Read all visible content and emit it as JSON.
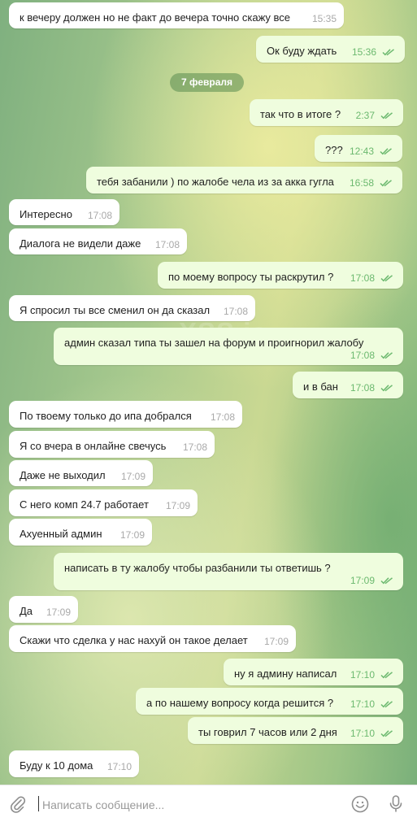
{
  "date_separator": "7 февраля",
  "watermark": "XSS.is",
  "messages": [
    {
      "dir": "in",
      "text": "к вечеру должен но не факт до вечера точно скажу все",
      "time": "15:35"
    },
    {
      "dir": "out",
      "text": "Ок буду ждать",
      "time": "15:36"
    },
    {
      "dir": "out",
      "text": "так что в итоге ?",
      "time": "2:37"
    },
    {
      "dir": "out",
      "text": "???",
      "time": "12:43"
    },
    {
      "dir": "out",
      "text": "тебя забанили ) по жалобе чела из за акка гугла",
      "time": "16:58"
    },
    {
      "dir": "in",
      "text": "Интересно",
      "time": "17:08"
    },
    {
      "dir": "in",
      "text": "Диалога не видели даже",
      "time": "17:08"
    },
    {
      "dir": "out",
      "text": "по моему вопросу ты раскрутил ?",
      "time": "17:08"
    },
    {
      "dir": "in",
      "text": "Я спросил ты все сменил он да сказал",
      "time": "17:08"
    },
    {
      "dir": "out",
      "text": "админ сказал типа ты зашел на форум и проигнорил жалобу",
      "time": "17:08"
    },
    {
      "dir": "out",
      "text": "и в бан",
      "time": "17:08"
    },
    {
      "dir": "in",
      "text": "По твоему только до ипа добрался",
      "time": "17:08"
    },
    {
      "dir": "in",
      "text": "Я со вчера в онлайне свечусь",
      "time": "17:08"
    },
    {
      "dir": "in",
      "text": "Даже не выходил",
      "time": "17:09"
    },
    {
      "dir": "in",
      "text": "С него комп 24.7 работает",
      "time": "17:09"
    },
    {
      "dir": "in",
      "text": "Ахуенный админ",
      "time": "17:09"
    },
    {
      "dir": "out",
      "text": "написать в ту жалобу чтобы разбанили ты ответишь ?",
      "time": "17:09"
    },
    {
      "dir": "in",
      "text": "Да",
      "time": "17:09"
    },
    {
      "dir": "in",
      "text": "Скажи что сделка у нас нахуй он такое делает",
      "time": "17:09"
    },
    {
      "dir": "out",
      "text": "ну я админу написал",
      "time": "17:10"
    },
    {
      "dir": "out",
      "text": "а по нашему вопросу когда решится ?",
      "time": "17:10"
    },
    {
      "dir": "out",
      "text": "ты говрил 7 часов или 2 дня",
      "time": "17:10"
    },
    {
      "dir": "in",
      "text": "Буду к 10 дома",
      "time": "17:10"
    }
  ],
  "composer": {
    "placeholder": "Написать сообщение..."
  },
  "icons": {
    "attach": "paperclip-icon",
    "emoji": "emoji-icon",
    "voice": "microphone-icon",
    "read": "double-check-icon"
  },
  "colors": {
    "outgoing_bubble": "#effdde",
    "incoming_bubble": "#ffffff",
    "check": "#6cb96f",
    "accent": "#5aa55e"
  }
}
